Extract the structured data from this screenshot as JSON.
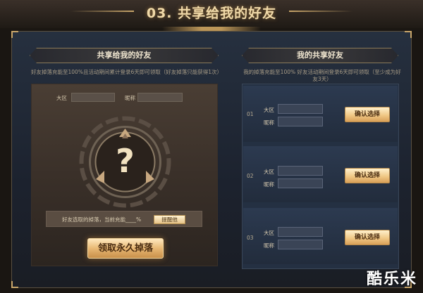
{
  "header": {
    "title": "03. 共享给我的好友"
  },
  "left": {
    "title": "共享给我的好友",
    "desc": "好友掉落充能至100%且活动期间累计登录6天即可领取（好友掉落只能获得1次）",
    "region_label": "大区",
    "nickname_label": "昵称",
    "emblem_icon": "question-emblem",
    "share_text": "好友选取的掉落，当前充能____%",
    "remind_label": "提醒他",
    "claim_label": "领取永久掉落"
  },
  "right": {
    "title": "我的共享好友",
    "desc": "我的掉落充能至100% 好友活动期间登录6天即可领取（至少成为好友3天）",
    "rows": [
      {
        "num": "01",
        "region_label": "大区",
        "nickname_label": "昵称",
        "confirm_label": "确认选择"
      },
      {
        "num": "02",
        "region_label": "大区",
        "nickname_label": "昵称",
        "confirm_label": "确认选择"
      },
      {
        "num": "03",
        "region_label": "大区",
        "nickname_label": "昵称",
        "confirm_label": "确认选择"
      }
    ]
  },
  "watermark": "酷乐米",
  "colors": {
    "gold": "#e8b874",
    "panel_blue": "#243042",
    "panel_brown": "#3a3029"
  }
}
